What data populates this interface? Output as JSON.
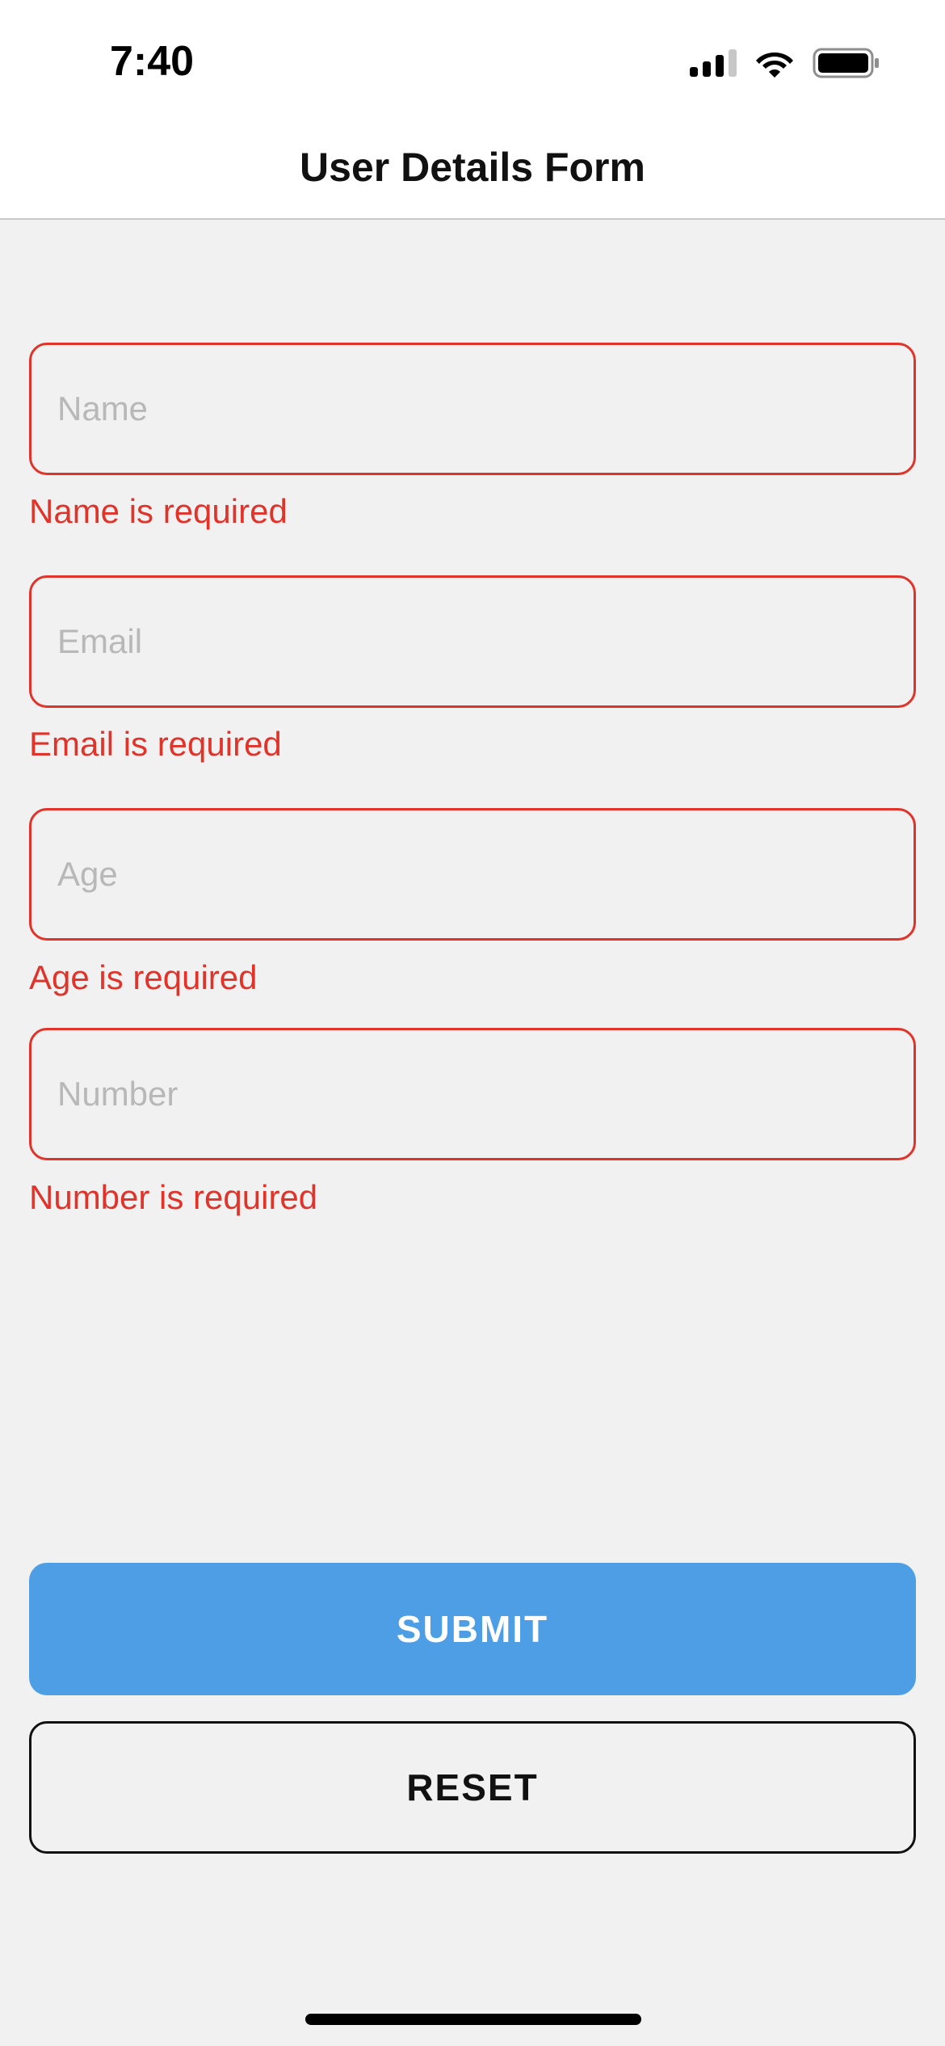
{
  "status_bar": {
    "time": "7:40",
    "icons": [
      "cellular-signal-icon",
      "wifi-icon",
      "battery-icon"
    ]
  },
  "header": {
    "title": "User Details Form"
  },
  "form": {
    "fields": [
      {
        "placeholder": "Name",
        "value": "",
        "error": "Name is required"
      },
      {
        "placeholder": "Email",
        "value": "",
        "error": "Email is required"
      },
      {
        "placeholder": "Age",
        "value": "",
        "error": "Age is required"
      },
      {
        "placeholder": "Number",
        "value": "",
        "error": "Number is required"
      }
    ],
    "submit_label": "SUBMIT",
    "reset_label": "RESET"
  },
  "colors": {
    "error": "#e0342b",
    "primary": "#4e9ee6",
    "background": "#f1f1f1",
    "surface": "#ffffff"
  }
}
